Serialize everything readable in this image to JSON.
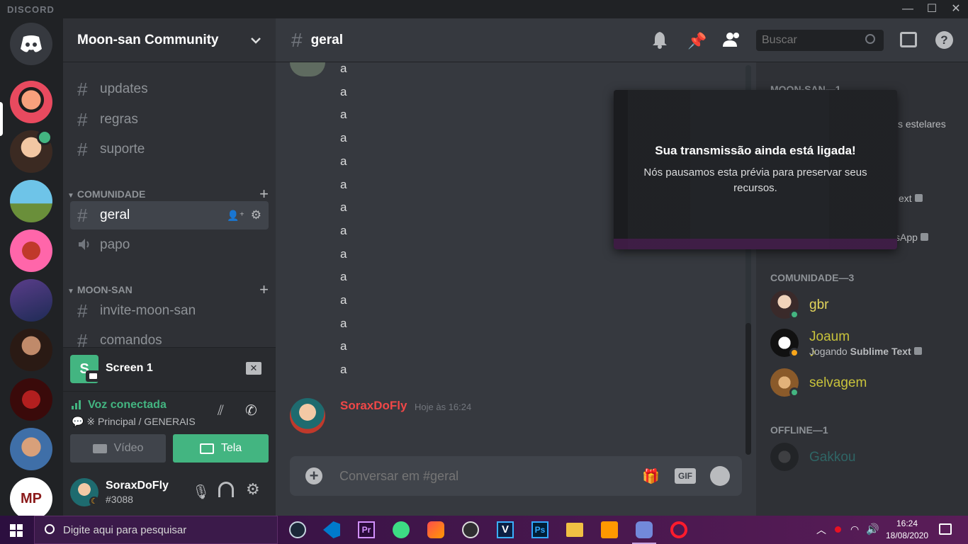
{
  "app": {
    "brand": "DISCORD"
  },
  "window_controls": {
    "minimize": "—",
    "maximize": "☐",
    "close": "✕"
  },
  "server": {
    "name": "Moon-san Community"
  },
  "channels": {
    "top": [
      {
        "name": "updates"
      },
      {
        "name": "regras"
      },
      {
        "name": "suporte"
      }
    ],
    "categories": [
      {
        "name": "COMUNIDADE",
        "channels": [
          {
            "name": "geral",
            "type": "text",
            "active": true
          },
          {
            "name": "papo",
            "type": "voice"
          }
        ]
      },
      {
        "name": "MOON-SAN",
        "channels": [
          {
            "name": "invite-moon-san",
            "type": "text"
          },
          {
            "name": "comandos",
            "type": "text"
          }
        ]
      }
    ]
  },
  "stream": {
    "title": "Screen 1"
  },
  "voice": {
    "status": "Voz conectada",
    "location": "※ Principal / GENERAIS",
    "video_label": "Vídeo",
    "screen_label": "Tela"
  },
  "user": {
    "name": "SoraxDoFly",
    "tag": "#3088"
  },
  "chat": {
    "channel_name": "geral",
    "lines": [
      "a",
      "a",
      "a",
      "a",
      "a",
      "a",
      "a",
      "a",
      "a",
      "a",
      "a",
      "a",
      "a",
      "a"
    ],
    "last_message": {
      "author": "SoraxDoFly",
      "timestamp": "Hoje às 16:24"
    },
    "composer_placeholder": "Conversar em #geral"
  },
  "header": {
    "search_placeholder": "Buscar"
  },
  "members": {
    "group1_label": "MOON-SAN—1",
    "partial_texts": [
      "s estelares",
      "ext",
      "sApp"
    ],
    "group2_label": "COMUNIDADE—3",
    "offline_label": "OFFLINE—1",
    "list": [
      {
        "name": "gbr",
        "activity": ""
      },
      {
        "name": "Joaum ♪",
        "activity_prefix": "Jogando ",
        "activity": "Sublime Text"
      },
      {
        "name": "selvagem",
        "activity": ""
      }
    ],
    "offline": [
      {
        "name": "Gakkou"
      }
    ]
  },
  "overlay": {
    "title": "Sua transmissão ainda está ligada!",
    "body": "Nós pausamos esta prévia para preservar seus recursos."
  },
  "taskbar": {
    "search_placeholder": "Digite aqui para pesquisar",
    "time": "16:24",
    "date": "18/08/2020"
  },
  "colors": {
    "accent": "#7289da",
    "green": "#43b581",
    "red_author": "#f04747",
    "member_gold": "#c9c33b",
    "gbr_color": "#e3d55c",
    "offline_teal": "#2a7d7b"
  }
}
